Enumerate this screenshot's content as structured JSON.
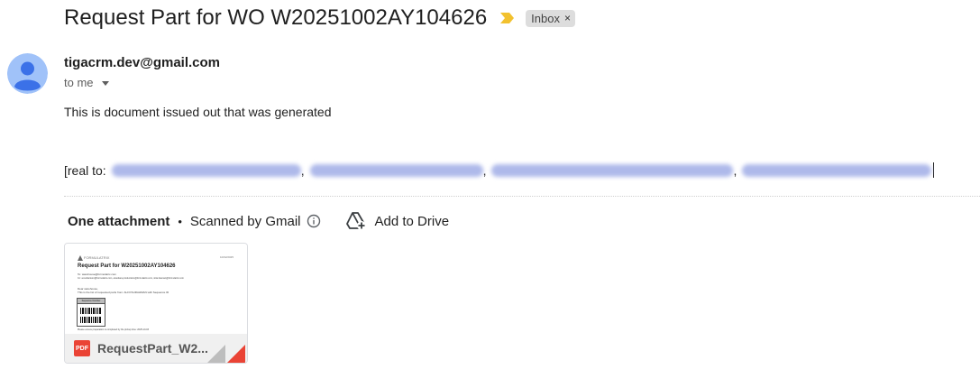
{
  "email": {
    "subject": "Request Part for WO W20251002AY104626",
    "label": "Inbox",
    "label_remove": "×",
    "sender": "tigacrm.dev@gmail.com",
    "to_line": "to me",
    "body": "This is document issued out that was generated",
    "real_to_label": "[real to:",
    "real_to_separator": ","
  },
  "attachments": {
    "count_label": "One attachment",
    "separator": "•",
    "scan_label": "Scanned by Gmail",
    "add_to_drive_label": "Add to Drive",
    "file": {
      "name": "RequestPart_W2...",
      "type_badge": "PDF",
      "preview": {
        "logo": "FORMULATRIX",
        "date": "10/02/2025",
        "title": "Request Part for W20251002AY104626",
        "to_line": "To: warehouse@formulatrix.com",
        "cc_line": "Cc: ai.subiantoro@formulatrix.com, arandara.productions@formulatrix.com, sitta.lisaman@formulatrix.com",
        "greeting": "Dear warehouse,",
        "request_line": "This is the list of requested parts from: ALFIYAURAHMAN with Sequence ID",
        "table_header": "Sequence Number",
        "footer_note": "Please ensure preparation is completed by the pickup time: 2025-10-03"
      }
    }
  },
  "colors": {
    "avatar_bg": "#a0c2f9",
    "avatar_fg": "#3b71e8",
    "importance": "#f2c12e",
    "pdf_red": "#ea4335"
  }
}
